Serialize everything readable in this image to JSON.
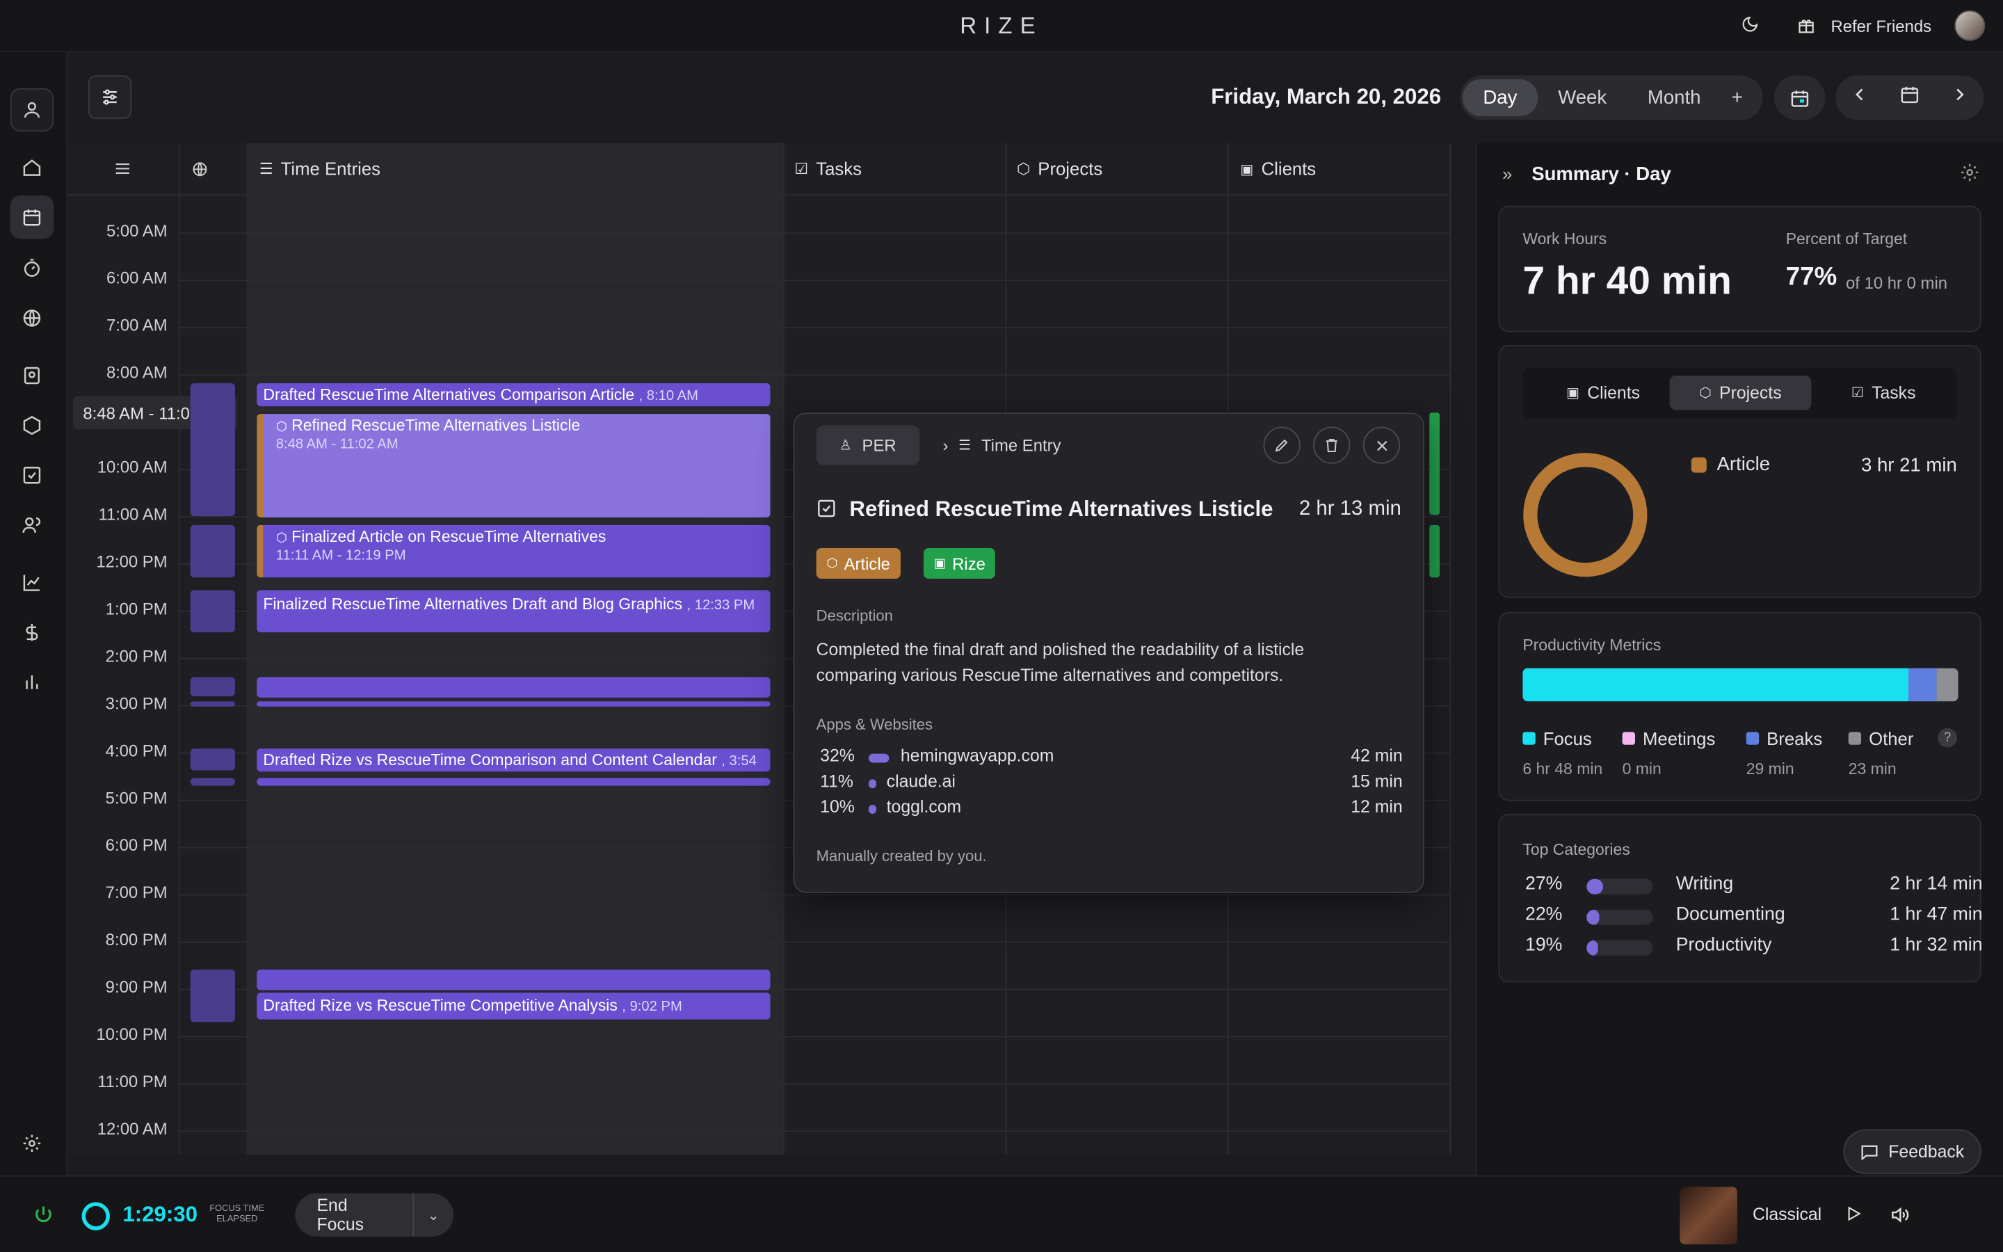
{
  "app": {
    "logo": "RIZE",
    "refer": "Refer Friends"
  },
  "header": {
    "date": "Friday, March 20, 2026",
    "views": [
      "Day",
      "Week",
      "Month"
    ],
    "add": "+"
  },
  "columns": {
    "entries": "Time Entries",
    "tasks": "Tasks",
    "projects": "Projects",
    "clients": "Clients"
  },
  "hours": [
    "5:00 AM",
    "6:00 AM",
    "7:00 AM",
    "8:00 AM",
    "10:00 AM",
    "11:00 AM",
    "12:00 PM",
    "1:00 PM",
    "2:00 PM",
    "3:00 PM",
    "4:00 PM",
    "5:00 PM",
    "6:00 PM",
    "7:00 PM",
    "8:00 PM",
    "9:00 PM",
    "10:00 PM",
    "11:00 PM",
    "12:00 AM"
  ],
  "tooltip": "8:48 AM - 11:02 AM",
  "events": {
    "e1": {
      "title": "Drafted RescueTime Alternatives Comparison Article",
      "time": ", 8:10 AM"
    },
    "e2": {
      "title": "Refined RescueTime Alternatives Listicle",
      "time": "8:48 AM - 11:02 AM"
    },
    "e3": {
      "title": "Finalized Article on RescueTime Alternatives",
      "time": "11:11 AM - 12:19 PM"
    },
    "e4": {
      "title": "Finalized RescueTime Alternatives Draft and Blog Graphics",
      "time": ", 12:33 PM"
    },
    "e5": {
      "title": "Drafted Rize vs RescueTime Comparison and Content Calendar",
      "time": ", 3:54"
    },
    "e6": {
      "title": "Drafted Rize vs RescueTime Competitive Analysis",
      "time": ", 9:02 PM"
    }
  },
  "popup": {
    "client": "PER",
    "type": "Time Entry",
    "title": "Refined RescueTime Alternatives Listicle",
    "duration": "2 hr 13 min",
    "tags": [
      "Article",
      "Rize"
    ],
    "desc_label": "Description",
    "description": "Completed the final draft and polished the readability of a listicle comparing various RescueTime alternatives and competitors.",
    "apps_label": "Apps & Websites",
    "apps": [
      {
        "pct": "32%",
        "name": "hemingwayapp.com",
        "min": "42 min"
      },
      {
        "pct": "11%",
        "name": "claude.ai",
        "min": "15 min"
      },
      {
        "pct": "10%",
        "name": "toggl.com",
        "min": "12 min"
      }
    ],
    "footer": "Manually created by you."
  },
  "summary": {
    "title": "Summary · Day",
    "work_label": "Work Hours",
    "work": "7 hr 40 min",
    "pct_label": "Percent of Target",
    "pct": "77%",
    "pct_of": "of 10 hr 0 min",
    "tabs": [
      "Clients",
      "Projects",
      "Tasks"
    ],
    "project": "Article",
    "project_time": "3 hr 21 min",
    "prod_label": "Productivity Metrics",
    "metrics": [
      {
        "name": "Focus",
        "val": "6 hr 48 min",
        "color": "#18e0f0"
      },
      {
        "name": "Meetings",
        "val": "0 min",
        "color": "#f3b6f0"
      },
      {
        "name": "Breaks",
        "val": "29 min",
        "color": "#5f7fe0"
      },
      {
        "name": "Other",
        "val": "23 min",
        "color": "#8e8e95"
      }
    ],
    "metric_fractions": {
      "focus": 0.887,
      "breaks": 0.063,
      "other": 0.05
    },
    "top_label": "Top Categories",
    "cats": [
      {
        "pct": "27%",
        "name": "Writing",
        "time": "2 hr 14 min"
      },
      {
        "pct": "22%",
        "name": "Documenting",
        "time": "1 hr 47 min"
      },
      {
        "pct": "19%",
        "name": "Productivity",
        "time": "1 hr 32 min"
      }
    ]
  },
  "bottom": {
    "timer": "1:29:30",
    "timer_lbl1": "FOCUS TIME",
    "timer_lbl2": "ELAPSED",
    "end": "End Focus",
    "music": "Classical",
    "feedback": "Feedback"
  },
  "colors": {
    "accent": "#6a4fd1",
    "focus": "#18e0f0",
    "article": "#b67a36",
    "rize": "#22a04b"
  }
}
